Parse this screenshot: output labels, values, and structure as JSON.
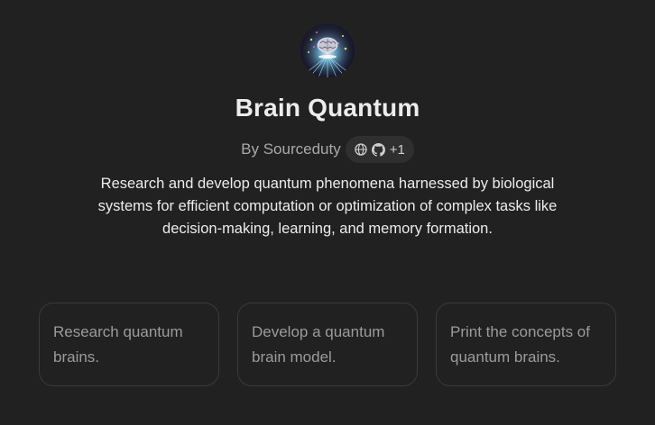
{
  "gpt": {
    "name": "Brain Quantum",
    "author": "By Sourceduty",
    "links_extra": "+1",
    "description": "Research and develop quantum phenomena harnessed by biological systems for efficient computation or optimization of complex tasks like decision-making, learning, and memory formation.",
    "avatar_icon": "brain-quantum-avatar",
    "link_icons": [
      "globe-icon",
      "github-icon"
    ]
  },
  "starters": [
    {
      "label": "Research quantum brains."
    },
    {
      "label": "Develop a quantum brain model."
    },
    {
      "label": "Print the concepts of quantum brains."
    }
  ],
  "colors": {
    "background": "#212121",
    "text": "#ececec",
    "muted": "#a9a9a9",
    "card_border": "#3a3a3a",
    "pill_bg": "#2f2f2f"
  }
}
